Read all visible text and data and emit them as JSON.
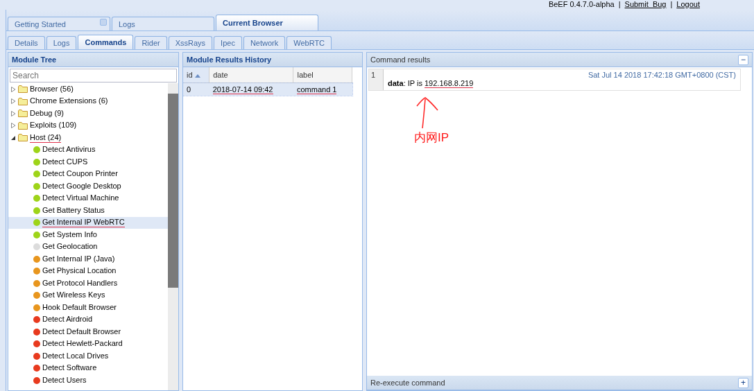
{
  "header": {
    "product": "BeEF",
    "version": "0.4.7.0-alpha",
    "separator": "|",
    "links": [
      "Submit_Bug",
      "Logout"
    ]
  },
  "main_tabs": [
    {
      "label": "Getting Started",
      "selected": false,
      "closable": true
    },
    {
      "label": "Logs",
      "selected": false,
      "closable": false
    },
    {
      "label": "Current Browser",
      "selected": true,
      "closable": false
    }
  ],
  "sub_tabs": [
    {
      "label": "Details",
      "selected": false
    },
    {
      "label": "Logs",
      "selected": false
    },
    {
      "label": "Commands",
      "selected": true
    },
    {
      "label": "Rider",
      "selected": false
    },
    {
      "label": "XssRays",
      "selected": false
    },
    {
      "label": "Ipec",
      "selected": false
    },
    {
      "label": "Network",
      "selected": false
    },
    {
      "label": "WebRTC",
      "selected": false
    }
  ],
  "module_tree": {
    "title": "Module Tree",
    "search": {
      "placeholder": "Search"
    },
    "items": [
      {
        "label": "Browser (56)",
        "expanded": false,
        "underlined": false
      },
      {
        "label": "Chrome Extensions (6)",
        "expanded": false,
        "underlined": false
      },
      {
        "label": "Debug (9)",
        "expanded": false,
        "underlined": false
      },
      {
        "label": "Exploits (109)",
        "expanded": false,
        "underlined": false
      },
      {
        "label": "Host (24)",
        "expanded": true,
        "underlined": true,
        "children": [
          {
            "label": "Detect Antivirus",
            "color": "#9ed419",
            "selected": false,
            "underlined": false
          },
          {
            "label": "Detect CUPS",
            "color": "#9ed419",
            "selected": false,
            "underlined": false
          },
          {
            "label": "Detect Coupon Printer",
            "color": "#9ed419",
            "selected": false,
            "underlined": false
          },
          {
            "label": "Detect Google Desktop",
            "color": "#9ed419",
            "selected": false,
            "underlined": false
          },
          {
            "label": "Detect Virtual Machine",
            "color": "#9ed419",
            "selected": false,
            "underlined": false
          },
          {
            "label": "Get Battery Status",
            "color": "#9ed419",
            "selected": false,
            "underlined": false
          },
          {
            "label": "Get Internal IP WebRTC",
            "color": "#9ed419",
            "selected": true,
            "underlined": true
          },
          {
            "label": "Get System Info",
            "color": "#9ed419",
            "selected": false,
            "underlined": false
          },
          {
            "label": "Get Geolocation",
            "color": "#dcdcdc",
            "selected": false,
            "underlined": false
          },
          {
            "label": "Get Internal IP (Java)",
            "color": "#e8961e",
            "selected": false,
            "underlined": false
          },
          {
            "label": "Get Physical Location",
            "color": "#e8961e",
            "selected": false,
            "underlined": false
          },
          {
            "label": "Get Protocol Handlers",
            "color": "#e8961e",
            "selected": false,
            "underlined": false
          },
          {
            "label": "Get Wireless Keys",
            "color": "#e8961e",
            "selected": false,
            "underlined": false
          },
          {
            "label": "Hook Default Browser",
            "color": "#e8961e",
            "selected": false,
            "underlined": false
          },
          {
            "label": "Detect Airdroid",
            "color": "#e83a1e",
            "selected": false,
            "underlined": false
          },
          {
            "label": "Detect Default Browser",
            "color": "#e83a1e",
            "selected": false,
            "underlined": false
          },
          {
            "label": "Detect Hewlett-Packard",
            "color": "#e83a1e",
            "selected": false,
            "underlined": false
          },
          {
            "label": "Detect Local Drives",
            "color": "#e83a1e",
            "selected": false,
            "underlined": false
          },
          {
            "label": "Detect Software",
            "color": "#e83a1e",
            "selected": false,
            "underlined": false
          },
          {
            "label": "Detect Users",
            "color": "#e83a1e",
            "selected": false,
            "underlined": false
          }
        ]
      }
    ]
  },
  "results_history": {
    "title": "Module Results History",
    "columns": [
      "id",
      "date",
      "label"
    ],
    "rows": [
      {
        "cells": [
          "0",
          "2018-07-14 09:42",
          "command 1"
        ],
        "selected": true,
        "underlined": true
      }
    ]
  },
  "command_results": {
    "title": "Command results",
    "collapse_symbol": "−",
    "entries": [
      {
        "number": "1",
        "timestamp": "Sat Jul 14 2018 17:42:18 GMT+0800 (CST)",
        "key": "data",
        "prefix": ": IP is ",
        "value": "192.168.8.219",
        "underlined": true
      }
    ],
    "annotation": "内网IP"
  },
  "reexecute": {
    "title": "Re-execute command",
    "expand_symbol": "+"
  }
}
